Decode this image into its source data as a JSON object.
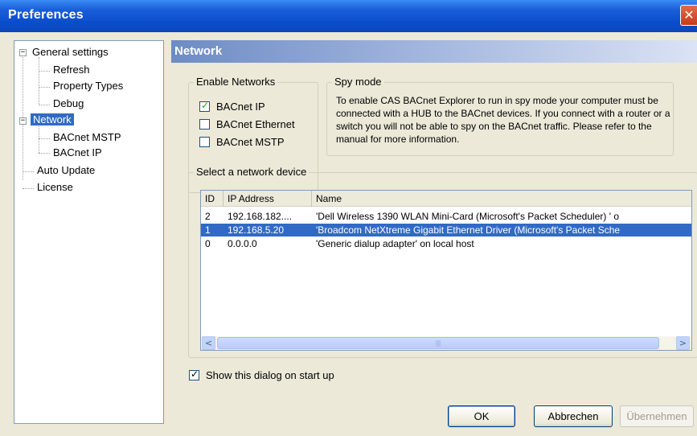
{
  "window": {
    "title": "Preferences",
    "close_glyph": "✕"
  },
  "tree": {
    "items": [
      {
        "label": "General settings",
        "expander": "−"
      },
      {
        "label": "Refresh"
      },
      {
        "label": "Property Types"
      },
      {
        "label": "Debug"
      },
      {
        "label": "Network",
        "expander": "−"
      },
      {
        "label": "BACnet MSTP"
      },
      {
        "label": "BACnet IP"
      },
      {
        "label": "Auto Update"
      },
      {
        "label": "License"
      }
    ]
  },
  "panel": {
    "header": "Network",
    "enable_networks": {
      "title": "Enable Networks",
      "options": [
        {
          "label": "BACnet IP",
          "checked": true
        },
        {
          "label": "BACnet Ethernet",
          "checked": false
        },
        {
          "label": "BACnet MSTP",
          "checked": false
        }
      ]
    },
    "spy_mode": {
      "title": "Spy mode",
      "text": "To enable CAS BACnet Explorer to run in spy mode your computer must be connected with a HUB to the BACnet devices. If you connect with a router or a switch you will not be able to spy on the BACnet traffic. Please refer to the manual for more information."
    },
    "device_group": {
      "title": "Select a network device",
      "columns": [
        "ID",
        "IP Address",
        "Name"
      ],
      "rows": [
        {
          "id": "2",
          "ip": "192.168.182....",
          "name": "'Dell Wireless 1390 WLAN Mini-Card (Microsoft's Packet Scheduler) ' o",
          "selected": false
        },
        {
          "id": "1",
          "ip": "192.168.5.20",
          "name": "'Broadcom NetXtreme Gigabit Ethernet Driver (Microsoft's Packet Sche",
          "selected": true
        },
        {
          "id": "0",
          "ip": "0.0.0.0",
          "name": "'Generic dialup adapter' on local host",
          "selected": false
        }
      ],
      "scroll_left": "<",
      "scroll_right": ">",
      "thumb_grip": "|||"
    },
    "show_on_startup": {
      "label": "Show this dialog on start up",
      "checked": true
    }
  },
  "buttons": {
    "ok": "OK",
    "cancel": "Abbrechen",
    "apply": "Übernehmen"
  },
  "colors": {
    "titlebar": "#0a4dcc",
    "selection": "#316ac5",
    "check": "#21a121"
  }
}
